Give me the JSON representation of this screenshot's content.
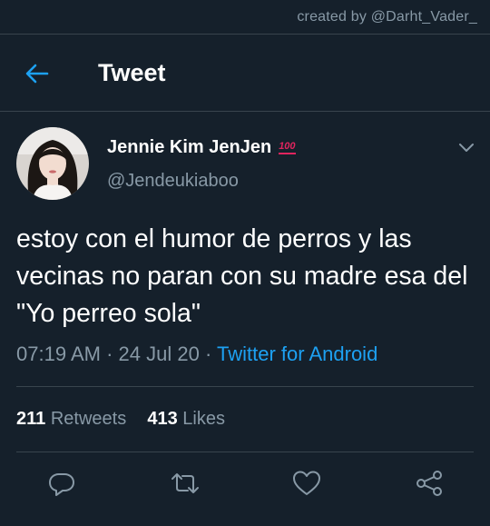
{
  "watermark": "created by @Darht_Vader_",
  "header": {
    "title": "Tweet"
  },
  "user": {
    "display_name": "Jennie Kim JenJen",
    "badge": "100",
    "handle": "@Jendeukiaboo"
  },
  "tweet": {
    "text": "estoy con el humor de perros y las vecinas no paran con su madre esa del \"Yo perreo sola\"",
    "time": "07:19 AM",
    "separator": "·",
    "date": "24 Jul 20",
    "source": "Twitter for Android"
  },
  "stats": {
    "retweets_count": "211",
    "retweets_label": "Retweets",
    "likes_count": "413",
    "likes_label": "Likes"
  },
  "colors": {
    "background": "#15202b",
    "accent": "#1da1f2",
    "muted": "#8899a6",
    "divider": "#38444d"
  },
  "icons": {
    "back": "arrow-left-icon",
    "more": "chevron-down-icon",
    "reply": "reply-icon",
    "retweet": "retweet-icon",
    "like": "heart-icon",
    "share": "share-icon"
  }
}
